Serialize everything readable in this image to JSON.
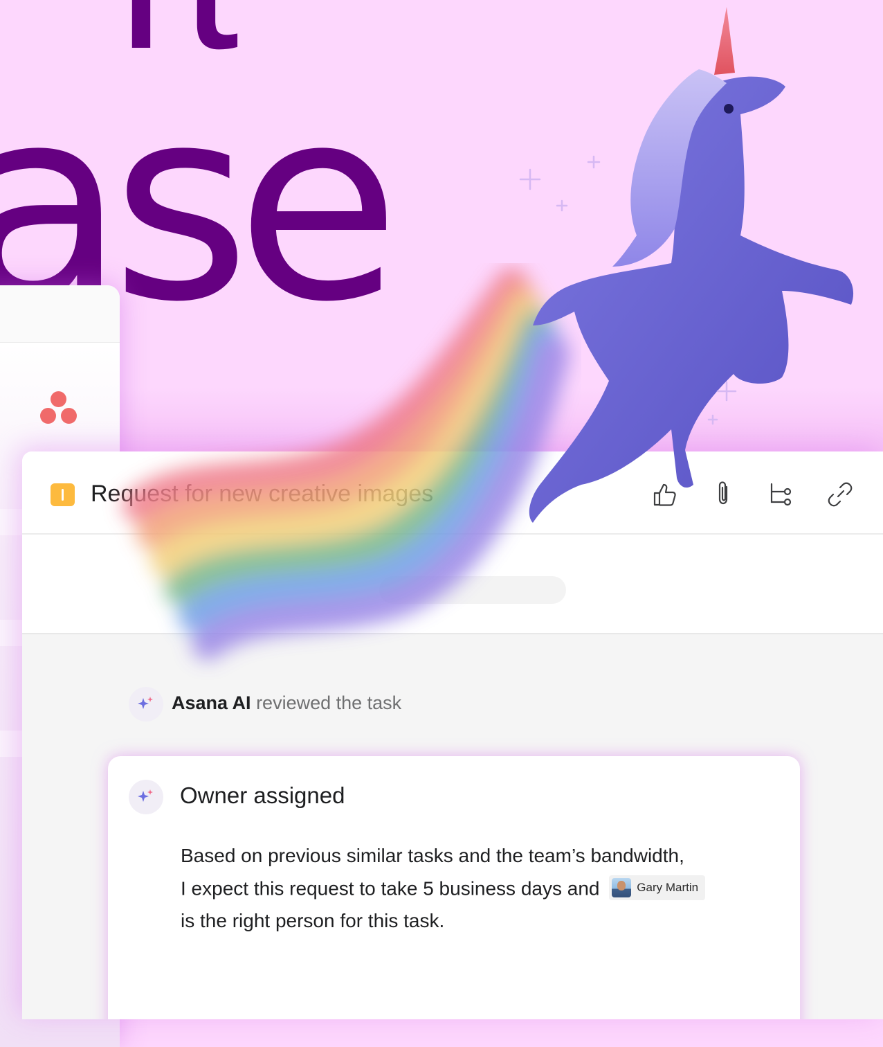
{
  "hero": {
    "headline_top": "rt",
    "headline": "ase"
  },
  "brand": {
    "logo_icon": "asana-logo-icon",
    "accent_color": "#f06a6a",
    "headline_color": "#650081",
    "background_color": "#fdd7fd"
  },
  "task": {
    "type_icon": "milestone-icon",
    "type_color": "#fdba3e",
    "title": "Request for new creative images",
    "toolbar": {
      "like_icon": "thumbs-up-icon",
      "attach_icon": "paperclip-icon",
      "subtask_icon": "subtask-icon",
      "link_icon": "link-icon"
    }
  },
  "activity": {
    "actor": "Asana AI",
    "action": "reviewed the task",
    "icon": "ai-sparkle-icon"
  },
  "owner_card": {
    "title": "Owner assigned",
    "line1": "Based on previous similar tasks and the team’s bandwidth,",
    "line2_before": "I expect this request to take 5 business days and",
    "mention_name": "Gary Martin",
    "line3": "is the right person for this task."
  }
}
